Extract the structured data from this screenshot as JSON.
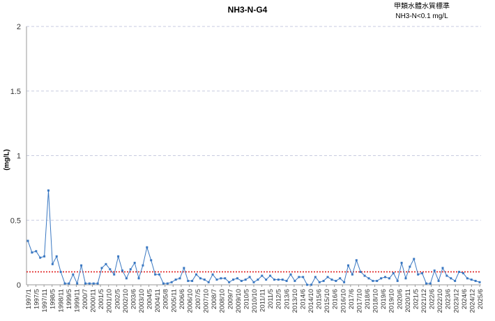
{
  "chart_data": {
    "type": "line",
    "title": "NH3-N-G4",
    "standard": {
      "line1": "甲類水體水質標準",
      "line2": "NH3-N<0.1 mg/L",
      "value": 0.1,
      "color": "#e02020"
    },
    "ylabel": "(mg/L)",
    "xlabel": "",
    "ylim": [
      0,
      2
    ],
    "yticks": [
      "0",
      "0.5",
      "1",
      "1.5",
      "2"
    ],
    "grid": true,
    "series_color": "#3a78c2",
    "x_labels": [
      "1997/1",
      "1997/5",
      "1997/11",
      "1998/5",
      "1998/11",
      "1999/5",
      "1999/11",
      "2000/7",
      "2000/11",
      "2001/5",
      "2001/10",
      "2002/5",
      "2002/10",
      "2003/6",
      "2003/10",
      "2004/5",
      "2004/11",
      "2005/8",
      "2005/11",
      "2006/6",
      "2006/10",
      "2007/5",
      "2007/10",
      "2008/7",
      "2008/10",
      "2009/7",
      "2009/10",
      "2010/5",
      "2010/10",
      "2011/11",
      "2011/5",
      "2012/5",
      "2013/6",
      "2013/10",
      "2014/6",
      "2014/10",
      "2015/6",
      "2015/10",
      "2016/6",
      "2016/10",
      "2017/6",
      "2017/10",
      "2018/6",
      "2018/10",
      "2019/6",
      "2019/10",
      "2020/6",
      "2020/11",
      "2021/5",
      "2021/12",
      "2022/6",
      "2022/10",
      "2023/6",
      "2023/12",
      "2024/6",
      "2024/12",
      "2025/6"
    ],
    "values": [
      0.34,
      0.25,
      0.26,
      0.21,
      0.22,
      0.73,
      0.16,
      0.22,
      0.1,
      0.01,
      0.01,
      0.08,
      0.01,
      0.15,
      0.01,
      0.01,
      0.01,
      0.01,
      0.13,
      0.16,
      0.12,
      0.08,
      0.22,
      0.11,
      0.05,
      0.12,
      0.17,
      0.05,
      0.15,
      0.29,
      0.19,
      0.08,
      0.08,
      0.01,
      0.01,
      0.02,
      0.04,
      0.05,
      0.13,
      0.03,
      0.03,
      0.08,
      0.05,
      0.04,
      0.02,
      0.08,
      0.04,
      0.05,
      0.05,
      0.02,
      0.04,
      0.05,
      0.03,
      0.04,
      0.06,
      0.02,
      0.04,
      0.07,
      0.04,
      0.07,
      0.04,
      0.04,
      0.04,
      0.03,
      0.08,
      0.03,
      0.06,
      0.06,
      0.0,
      0.0,
      0.06,
      0.02,
      0.03,
      0.06,
      0.04,
      0.03,
      0.05,
      0.02,
      0.15,
      0.08,
      0.19,
      0.1,
      0.07,
      0.05,
      0.03,
      0.03,
      0.05,
      0.06,
      0.05,
      0.09,
      0.03,
      0.17,
      0.05,
      0.14,
      0.2,
      0.08,
      0.09,
      0.01,
      0.01,
      0.11,
      0.03,
      0.13,
      0.07,
      0.05,
      0.03,
      0.1,
      0.09,
      0.05,
      0.04,
      0.03,
      0.02
    ]
  }
}
